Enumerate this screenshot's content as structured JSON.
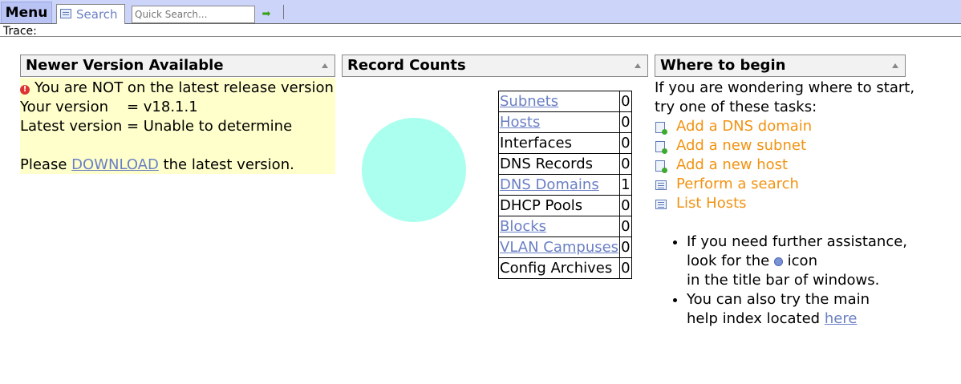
{
  "topbar": {
    "menu_label": "Menu",
    "search_tab_label": "Search",
    "quick_search_placeholder": "Quick Search...",
    "go_icon": "green-arrow-icon"
  },
  "trace_label": "Trace:",
  "version_panel": {
    "title": "Newer Version Available",
    "warning": "You are NOT on the latest release version",
    "your_version": "Your version    = v18.1.1",
    "latest_version": "Latest version = Unable to determine",
    "please": "Please",
    "download_link": "DOWNLOAD",
    "after_link": "the latest version."
  },
  "record_panel": {
    "title": "Record Counts",
    "pie_color": "#aaffee",
    "rows": [
      {
        "label": "Subnets",
        "count": "0",
        "link": true
      },
      {
        "label": "Hosts",
        "count": "0",
        "link": true
      },
      {
        "label": "Interfaces",
        "count": "0",
        "link": false
      },
      {
        "label": "DNS Records",
        "count": "0",
        "link": false
      },
      {
        "label": "DNS Domains",
        "count": "1",
        "link": true
      },
      {
        "label": "DHCP Pools",
        "count": "0",
        "link": false
      },
      {
        "label": "Blocks",
        "count": "0",
        "link": true
      },
      {
        "label": "VLAN Campuses",
        "count": "0",
        "link": true
      },
      {
        "label": "Config Archives",
        "count": "0",
        "link": false
      }
    ]
  },
  "begin_panel": {
    "title": "Where to begin",
    "intro_line1": "If you are wondering where to start,",
    "intro_line2": "try one of these tasks:",
    "tasks": [
      {
        "label": "Add a DNS domain",
        "icon": "add-page-icon"
      },
      {
        "label": "Add a new subnet",
        "icon": "add-page-icon"
      },
      {
        "label": "Add a new host",
        "icon": "add-page-icon"
      },
      {
        "label": "Perform a search",
        "icon": "search-form-icon"
      },
      {
        "label": "List Hosts",
        "icon": "list-icon"
      }
    ],
    "help1_line1": "If you need further assistance,",
    "help1_pre": "look for the",
    "help1_post": "icon",
    "help1_line3": "in the title bar of windows.",
    "help2_line1": "You can also try the main",
    "help2_pre": "help index located",
    "help2_link": "here"
  }
}
